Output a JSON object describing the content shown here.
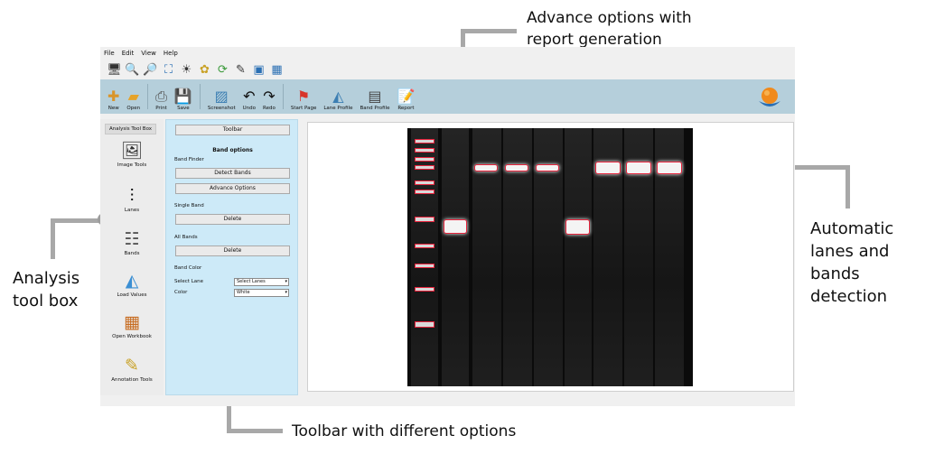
{
  "callouts": {
    "top_line1": "Advance options with",
    "top_line2": "report generation",
    "left_line1": "Analysis",
    "left_line2": "tool box",
    "right_line1": "Automatic",
    "right_line2": "lanes and",
    "right_line3": "bands",
    "right_line4": "detection",
    "bottom": "Toolbar with different options"
  },
  "menu": [
    "File",
    "Edit",
    "View",
    "Help"
  ],
  "quickbar_icons": [
    "monitor-icon",
    "zoom-in-icon",
    "zoom-out-icon",
    "fit-icon",
    "brightness-icon",
    "palette-icon",
    "refresh-icon",
    "brush-icon",
    "layers-icon",
    "grid-icon"
  ],
  "ribbon": {
    "new": "New",
    "open": "Open",
    "print": "Print",
    "save": "Save",
    "screenshot": "Screenshot",
    "undo": "Undo",
    "redo": "Redo",
    "start_page": "Start Page",
    "lane_profile": "Lane Profile",
    "band_profile": "Band Profile",
    "report": "Report"
  },
  "toolbox": {
    "title": "Analysis Tool Box",
    "image_tools": "Image Tools",
    "lanes": "Lanes",
    "bands": "Bands",
    "load_values": "Load Values",
    "open_workbook": "Open Workbook",
    "annotation_tools": "Annotation Tools"
  },
  "panel": {
    "toolbar_button": "Toolbar",
    "heading": "Band options",
    "band_finder": "Band Finder",
    "detect_bands": "Detect Bands",
    "advance_options": "Advance Options",
    "single_band": "Single Band",
    "delete_single": "Delete",
    "all_bands": "All Bands",
    "delete_all": "Delete",
    "band_color": "Band Color",
    "select_lane_label": "Select Lane",
    "select_lane_value": "Select Lanes",
    "color_label": "Color",
    "color_value": "White"
  },
  "colors": {
    "ribbon_bg": "#b5cfdb",
    "panel_bg": "#cdeaf8",
    "band_outline": "#e5213a",
    "gel_bg": "#0b0b0b"
  }
}
